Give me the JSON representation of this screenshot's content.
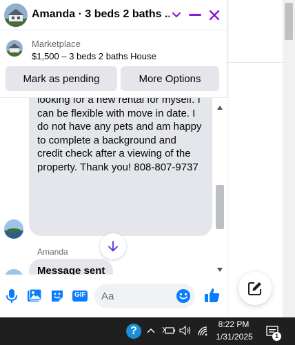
{
  "chat": {
    "title": "Amanda · 3 beds 2 baths ...",
    "marketplace_label": "Marketplace",
    "listing": "$1,500 – 3 beds 2 baths House",
    "mark_pending_label": "Mark as pending",
    "more_options_label": "More Options",
    "message_text": "looking for a new rental for myself. I can be flexible with move in date. I do not have any pets and am happy to complete a background and credit check after a viewing of the property. Thank you! 808-807-9737",
    "sender_name": "Amanda",
    "message2_text": "Message sent",
    "composer_placeholder": "Aa",
    "accent_color": "#8b18d8",
    "messenger_blue": "#0a7cff"
  },
  "icons": {
    "header": [
      "chevron-down-icon",
      "minimize-icon",
      "close-icon"
    ],
    "composer": [
      "microphone-icon",
      "photo-icon",
      "sticker-icon",
      "gif-icon",
      "emoji-icon",
      "like-icon"
    ],
    "other": [
      "scroll-down-arrow-icon",
      "new-message-icon"
    ]
  },
  "taskbar": {
    "time": "8:22 PM",
    "date": "1/31/2025",
    "gif_label": "GIF",
    "notification_count": "1",
    "help_glyph": "?"
  }
}
